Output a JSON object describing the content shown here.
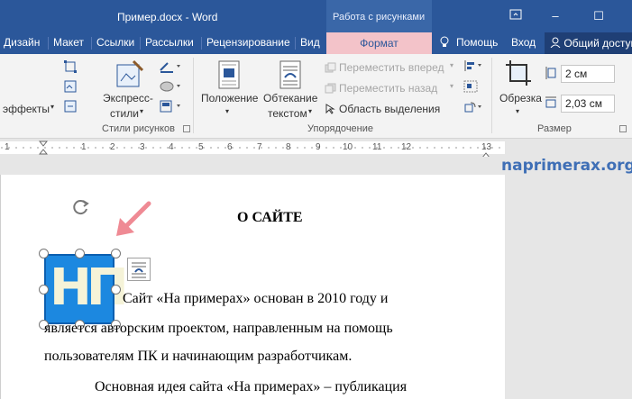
{
  "titlebar": {
    "doc_title": "Пример.docx - Word",
    "context_group": "Работа с рисунками",
    "restore_icon": "ribbon-display-icon",
    "minimize": "–",
    "maximize": "☐"
  },
  "tabs": {
    "items": [
      "Дизайн",
      "Макет",
      "Ссылки",
      "Рассылки",
      "Рецензирование",
      "Вид"
    ],
    "format": "Формат",
    "help": "Помощь",
    "signin": "Вход",
    "share": "Общий доступ"
  },
  "ribbon": {
    "effects": "эффекты",
    "express_styles_1": "Экспресс-",
    "express_styles_2": "стили",
    "group_picture_styles": "Стили рисунков",
    "position": "Положение",
    "wrap_1": "Обтекание",
    "wrap_2": "текстом",
    "bring_forward": "Переместить вперед",
    "send_backward": "Переместить назад",
    "selection_pane": "Область выделения",
    "group_arrange": "Упорядочение",
    "crop": "Обрезка",
    "height": "2 см",
    "width": "2,03 см",
    "group_size": "Размер"
  },
  "ruler": {
    "numbers": [
      "1",
      "1",
      "2",
      "3",
      "4",
      "5",
      "6",
      "7",
      "8",
      "9",
      "10",
      "11",
      "12",
      "13"
    ]
  },
  "document": {
    "watermark": "naprimerax.org",
    "heading": "О САЙТЕ",
    "line1": "Сайт «На примерах» основан в 2010 году и",
    "line2": "является авторским проектом, направленным на помощь",
    "line3": "пользователям ПК и начинающим разработчикам.",
    "line4": "Основная идея сайта «На примерах» – публикация",
    "logo_text": "НП"
  },
  "colors": {
    "title_blue": "#2b579a",
    "format_tab": "#f3c3c9",
    "logo_blue": "#1c88e0",
    "arrow_pink": "#ef8a94"
  }
}
